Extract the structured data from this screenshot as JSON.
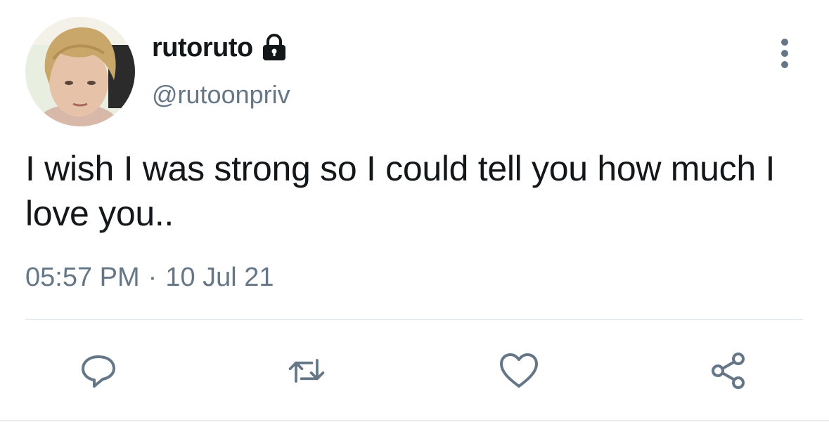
{
  "user": {
    "display_name": "rutoruto",
    "handle": "@rutoonpriv",
    "protected_icon": "lock-icon",
    "avatar": "profile-photo"
  },
  "tweet": {
    "text": "I wish I was strong so I could tell you how much I love you..",
    "time": "05:57 PM",
    "separator": "·",
    "date": "10 Jul 21"
  },
  "actions": [
    {
      "name": "reply",
      "icon": "comment-icon"
    },
    {
      "name": "retweet",
      "icon": "retweet-icon"
    },
    {
      "name": "like",
      "icon": "heart-icon"
    },
    {
      "name": "share",
      "icon": "share-icon"
    }
  ],
  "menu_icon": "more-vertical-icon",
  "colors": {
    "text": "#14171a",
    "secondary": "#657786",
    "divider": "#e6ecf0"
  }
}
